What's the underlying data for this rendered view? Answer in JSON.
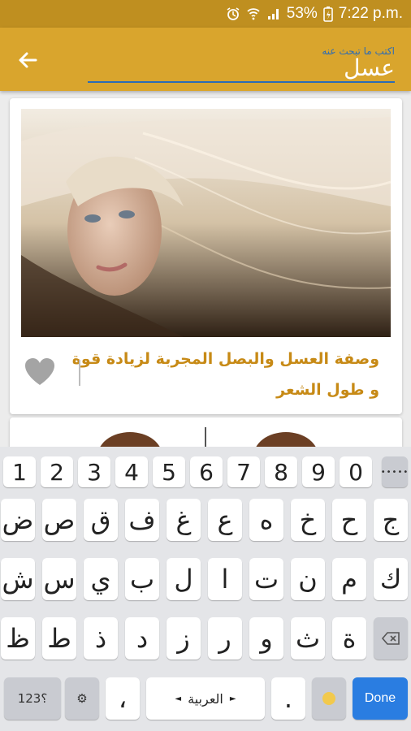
{
  "status_bar": {
    "battery": "53%",
    "time": "7:22 p.m."
  },
  "search": {
    "placeholder": "اكتب ما تبحث عنه",
    "value": "عسل"
  },
  "recipes": [
    {
      "title": "وصفة العسل والبصل المجربة لزيادة قوة و طول الشعر",
      "favorite": false
    }
  ],
  "keyboard": {
    "row_numbers": [
      "1",
      "2",
      "3",
      "4",
      "5",
      "6",
      "7",
      "8",
      "9",
      "0"
    ],
    "row1": [
      "ج",
      "ح",
      "خ",
      "ه",
      "ع",
      "غ",
      "ف",
      "ق",
      "ص",
      "ض"
    ],
    "row2": [
      "ك",
      "م",
      "ن",
      "ت",
      "ا",
      "ل",
      "ب",
      "ي",
      "س",
      "ش"
    ],
    "row3": [
      "ة",
      "ث",
      "و",
      "ر",
      "ز",
      "د",
      "ذ",
      "ط",
      "ظ"
    ],
    "symbols_label": "123؟",
    "comma": "،",
    "space_label": "العربية",
    "period": ".",
    "done_label": "Done"
  }
}
